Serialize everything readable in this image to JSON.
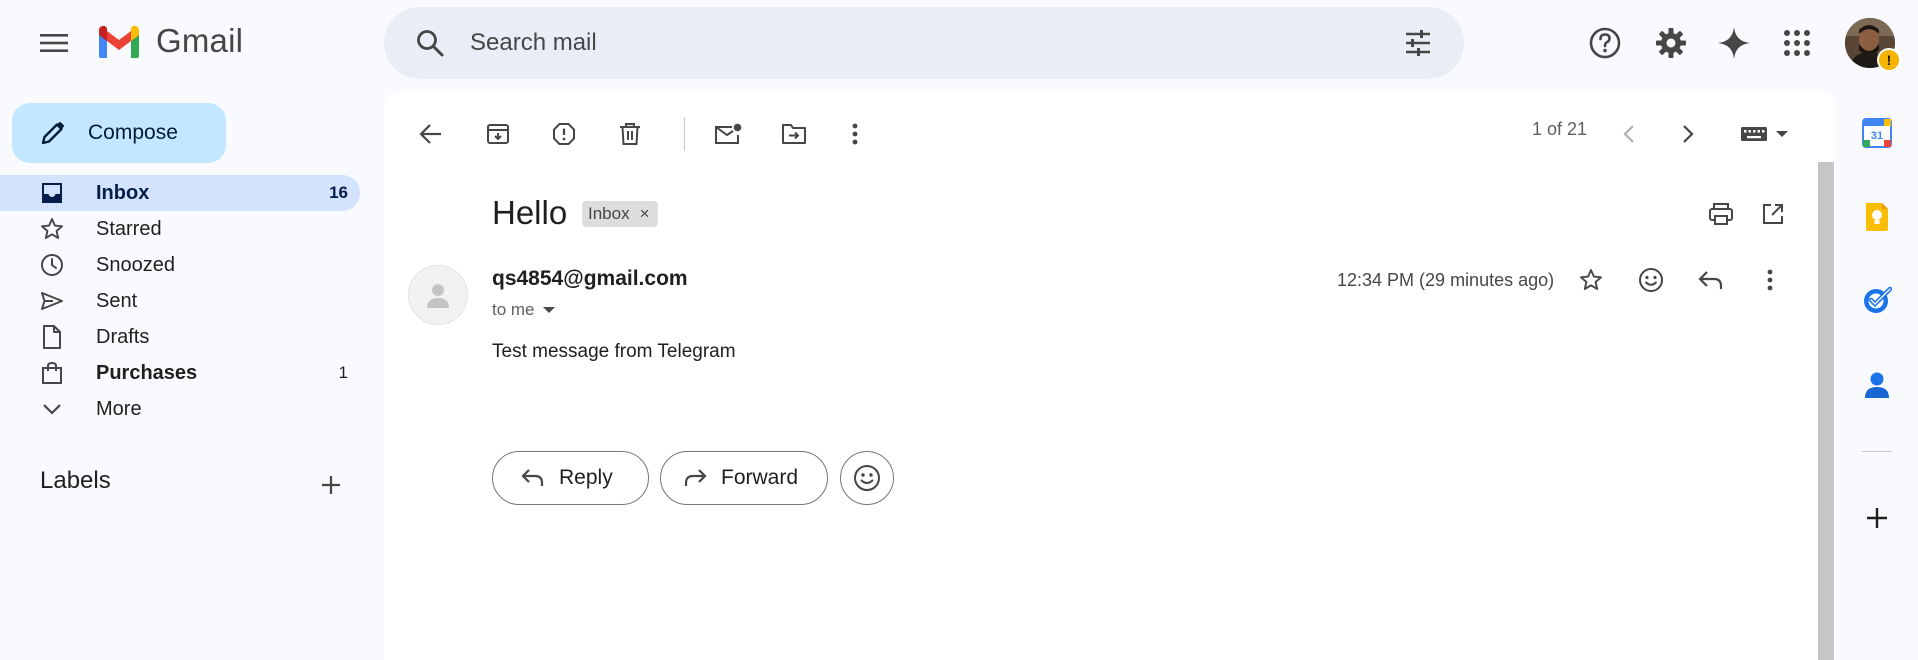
{
  "app": {
    "name": "Gmail"
  },
  "search": {
    "placeholder": "Search mail"
  },
  "sidebar": {
    "compose_label": "Compose",
    "items": [
      {
        "label": "Inbox",
        "count": "16",
        "icon": "inbox-icon"
      },
      {
        "label": "Starred",
        "count": "",
        "icon": "star-icon"
      },
      {
        "label": "Snoozed",
        "count": "",
        "icon": "clock-icon"
      },
      {
        "label": "Sent",
        "count": "",
        "icon": "send-icon"
      },
      {
        "label": "Drafts",
        "count": "",
        "icon": "draft-icon"
      },
      {
        "label": "Purchases",
        "count": "1",
        "icon": "shopping-bag-icon"
      },
      {
        "label": "More",
        "count": "",
        "icon": "chevron-down-icon"
      }
    ],
    "labels_heading": "Labels"
  },
  "toolbar": {
    "pager": "1 of 21"
  },
  "message": {
    "subject": "Hello",
    "label_chip": "Inbox",
    "chip_close": "×",
    "sender": "qs4854@gmail.com",
    "to": "to me",
    "timestamp": "12:34 PM (29 minutes ago)",
    "body": "Test message from Telegram"
  },
  "actions": {
    "reply_label": "Reply",
    "forward_label": "Forward"
  },
  "profile": {
    "warning_badge": "!"
  },
  "colors": {
    "background": "#f8fafd",
    "compose": "#c2e7ff",
    "active_nav": "#d3e3fd",
    "search": "#e9eef6",
    "warning": "#f6b400"
  }
}
